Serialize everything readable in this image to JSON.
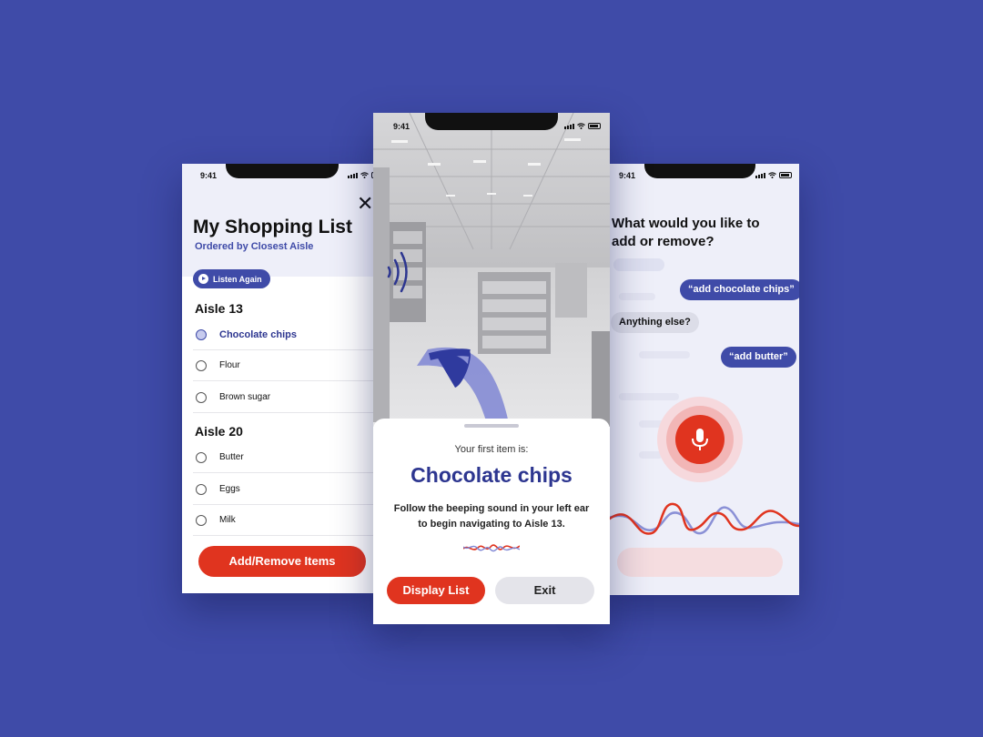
{
  "colors": {
    "background": "#3f4ba8",
    "accent_red": "#e0341f",
    "brand_blue": "#3f4ba8",
    "dark_blue_text": "#2d3690"
  },
  "left_screen": {
    "time": "9:41",
    "title": "My Shopping List",
    "subtitle": "Ordered by Closest Aisle",
    "close_icon": "close-icon",
    "listen_again": "Listen Again",
    "sections": [
      {
        "aisle": "Aisle 13",
        "items": [
          "Chocolate chips",
          "Flour",
          "Brown sugar"
        ]
      },
      {
        "aisle": "Aisle 20",
        "items": [
          "Butter",
          "Eggs",
          "Milk"
        ]
      }
    ],
    "add_button": "Add/Remove Items"
  },
  "center_screen": {
    "time": "9:41",
    "first_label": "Your first item is:",
    "item_name": "Chocolate chips",
    "instruction": "Follow the beeping sound in your left ear to begin navigating to Aisle 13.",
    "display_list_button": "Display List",
    "exit_button": "Exit"
  },
  "right_screen": {
    "time": "9:41",
    "question": "What would you like to add or remove?",
    "messages": [
      {
        "from": "user",
        "text": "“add chocolate chips”"
      },
      {
        "from": "app",
        "text": "Anything else?"
      },
      {
        "from": "user",
        "text": "“add butter”"
      }
    ],
    "mic_icon": "microphone-icon"
  }
}
